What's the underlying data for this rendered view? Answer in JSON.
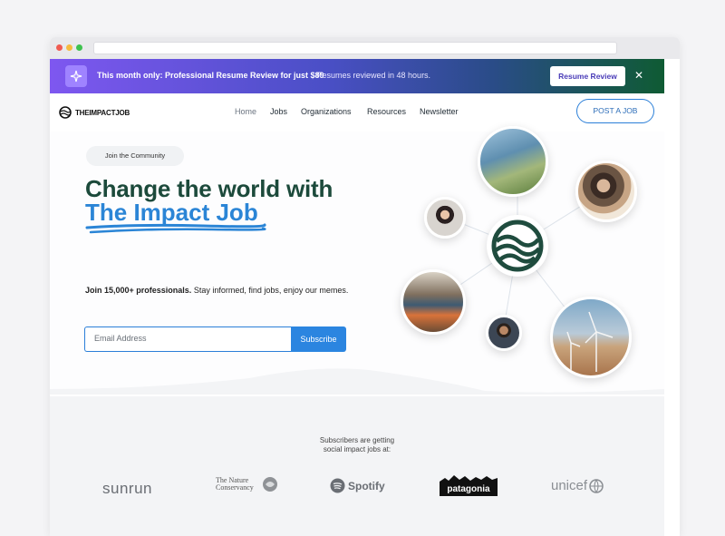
{
  "banner": {
    "promo_text": "This month only: Professional Resume Review for just $89",
    "sub_text": "Resumes reviewed in 48 hours.",
    "cta_label": "Resume Review",
    "close_symbol": "✕"
  },
  "nav": {
    "logo_text": "THEIMPACTJOB",
    "links": [
      "Home",
      "Jobs",
      "Organizations",
      "Resources",
      "Newsletter"
    ],
    "post_job_label": "POST A JOB"
  },
  "hero": {
    "pill_label": "Join the Community",
    "headline_line1": "Change the world with",
    "headline_line2": "The Impact Job",
    "lead_bold": "Join 15,000+ professionals.",
    "lead_rest": " Stay informed, find jobs, enjoy our memes.",
    "email_placeholder": "Email Address",
    "subscribe_label": "Subscribe"
  },
  "logos_section": {
    "caption_line1": "Subscribers are getting",
    "caption_line2": "social impact jobs at:",
    "brands": [
      "sunrun",
      "The Nature Conservancy",
      "Spotify",
      "patagonia",
      "unicef"
    ]
  },
  "colors": {
    "accent_blue": "#2b85e0",
    "headline_green": "#1c4a3b",
    "brand_green": "#1f4c3e"
  }
}
